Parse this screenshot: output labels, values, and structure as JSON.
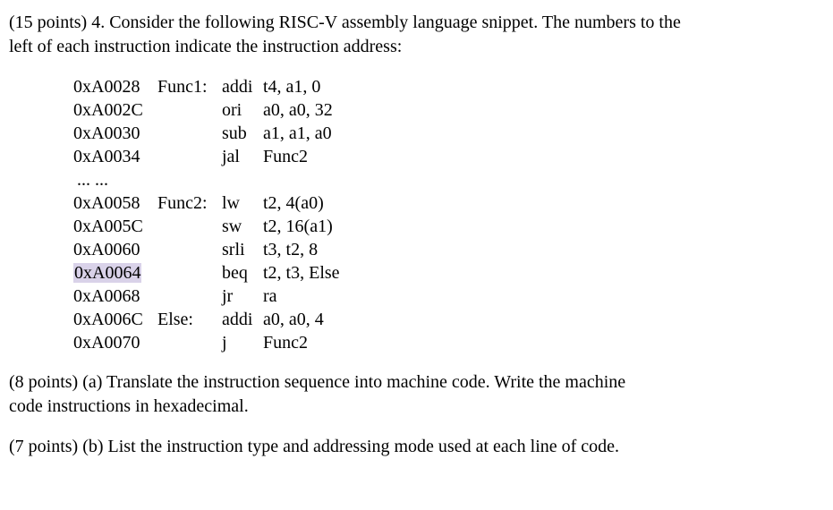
{
  "intro_line1": "(15 points) 4. Consider the following RISC-V assembly language snippet. The numbers to the",
  "intro_line2": "left of each instruction indicate the instruction address:",
  "code": {
    "lines": [
      {
        "addr": "0xA0028",
        "label": "Func1:",
        "mnemonic": "addi",
        "operands": "t4, a1, 0"
      },
      {
        "addr": "0xA002C",
        "label": "",
        "mnemonic": "ori",
        "operands": "a0, a0, 32"
      },
      {
        "addr": "0xA0030",
        "label": "",
        "mnemonic": "sub",
        "operands": "a1, a1, a0"
      },
      {
        "addr": "0xA0034",
        "label": "",
        "mnemonic": "jal",
        "operands": "Func2"
      }
    ],
    "ellipsis": "... ...",
    "lines2": [
      {
        "addr": "0xA0058",
        "label": "Func2:",
        "mnemonic": "lw",
        "operands": "t2, 4(a0)"
      },
      {
        "addr": "0xA005C",
        "label": "",
        "mnemonic": "sw",
        "operands": "t2, 16(a1)"
      },
      {
        "addr": "0xA0060",
        "label": "",
        "mnemonic": "srli",
        "operands": "t3, t2, 8"
      },
      {
        "addr": "0xA0064",
        "label": "",
        "mnemonic": "beq",
        "operands": "t2, t3, Else",
        "highlight_addr": true
      },
      {
        "addr": "0xA0068",
        "label": "",
        "mnemonic": "jr",
        "operands": "ra"
      },
      {
        "addr": "0xA006C",
        "label": "Else:",
        "mnemonic": "addi",
        "operands": "a0, a0, 4"
      },
      {
        "addr": "0xA0070",
        "label": "",
        "mnemonic": "j",
        "operands": "Func2"
      }
    ]
  },
  "part_a_line1": "(8 points) (a) Translate the instruction sequence into machine code. Write the machine",
  "part_a_line2": "code instructions in hexadecimal.",
  "part_b": "(7 points) (b) List the instruction type and addressing mode used at each line of code."
}
